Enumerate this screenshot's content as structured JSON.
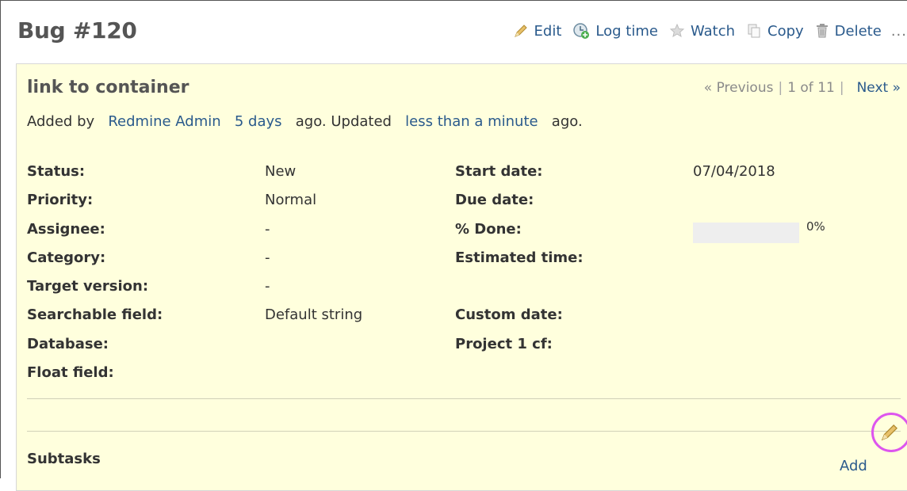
{
  "header": {
    "title": "Bug #120",
    "actions": {
      "edit": "Edit",
      "log_time": "Log time",
      "watch": "Watch",
      "copy": "Copy",
      "delete": "Delete",
      "more": "..."
    }
  },
  "issue": {
    "subject": "link to container",
    "nav": {
      "previous": "« Previous",
      "separator": "|",
      "position": "1 of 11",
      "next": "Next »"
    },
    "byline": {
      "added_by": "Added by",
      "author": "Redmine Admin",
      "created": "5 days",
      "ago_updated": "ago. Updated",
      "updated": "less than a minute",
      "ago": "ago."
    },
    "attributes": {
      "status": {
        "label": "Status:",
        "value": "New"
      },
      "start_date": {
        "label": "Start date:",
        "value": "07/04/2018"
      },
      "priority": {
        "label": "Priority:",
        "value": "Normal"
      },
      "due_date": {
        "label": "Due date:",
        "value": ""
      },
      "assignee": {
        "label": "Assignee:",
        "value": "-"
      },
      "done": {
        "label": "% Done:",
        "value": "0%",
        "fraction": 0
      },
      "category": {
        "label": "Category:",
        "value": "-"
      },
      "estimated_time": {
        "label": "Estimated time:",
        "value": ""
      },
      "target_version": {
        "label": "Target version:",
        "value": "-"
      },
      "searchable_field": {
        "label": "Searchable field:",
        "value": "Default string"
      },
      "custom_date": {
        "label": "Custom date:",
        "value": ""
      },
      "database": {
        "label": "Database:",
        "value": ""
      },
      "project1_cf": {
        "label": "Project 1 cf:",
        "value": ""
      },
      "float_field": {
        "label": "Float field:",
        "value": ""
      }
    },
    "subtasks": {
      "title": "Subtasks",
      "add": "Add"
    }
  },
  "colors": {
    "link": "#2a5a8c",
    "issue_background": "#ffffdd",
    "highlight": "#dd55ee"
  }
}
